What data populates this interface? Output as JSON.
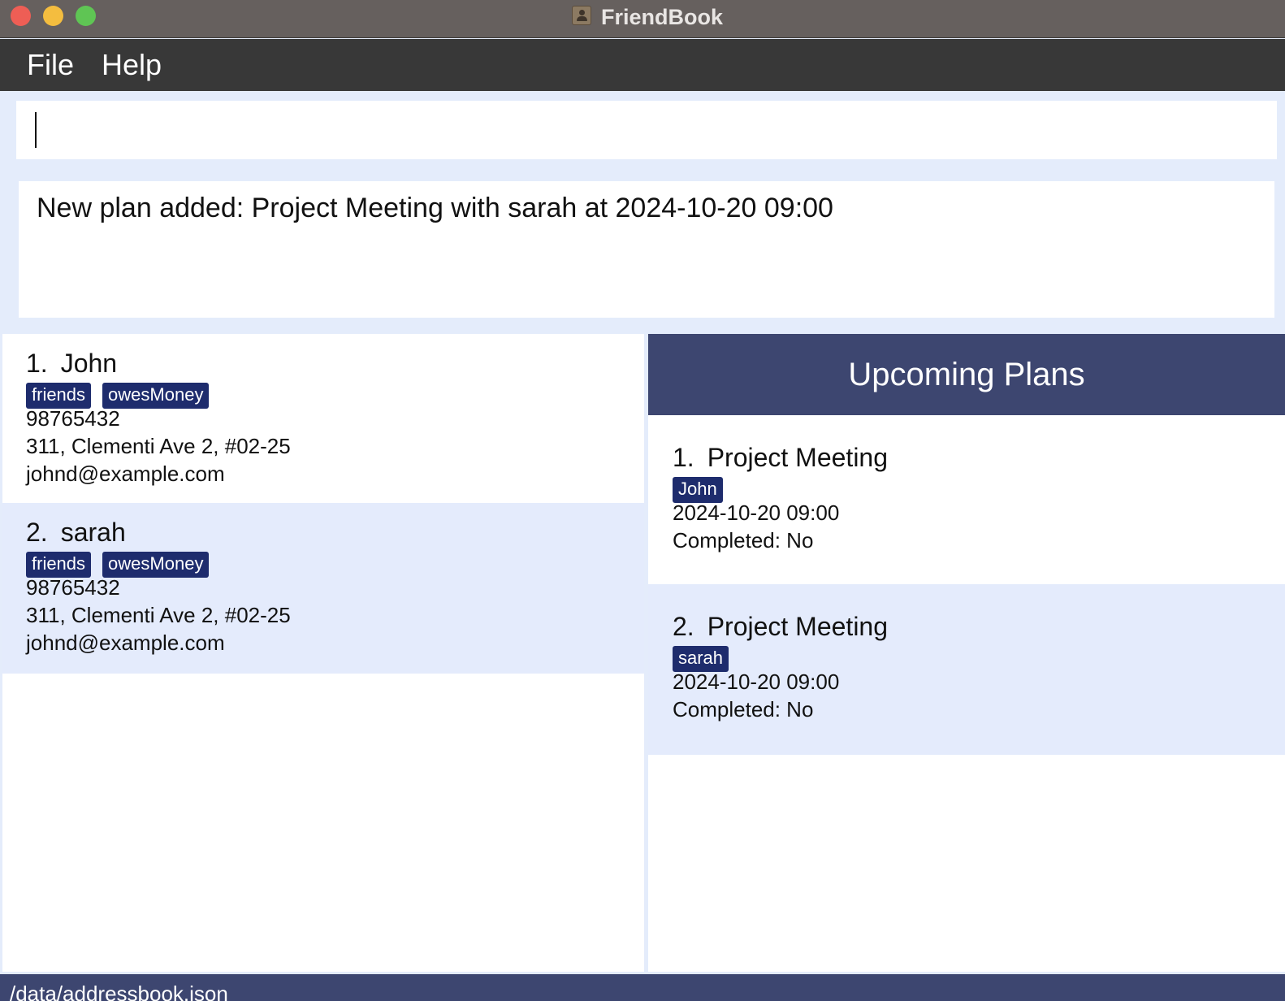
{
  "window": {
    "title": "FriendBook"
  },
  "menu": {
    "file": "File",
    "help": "Help"
  },
  "command": {
    "value": "",
    "placeholder": ""
  },
  "result": {
    "message": "New plan added: Project Meeting with sarah at 2024-10-20 09:00"
  },
  "persons": [
    {
      "index": "1.",
      "name": "John",
      "tags": [
        "friends",
        "owesMoney"
      ],
      "phone": "98765432",
      "address": "311, Clementi Ave 2, #02-25",
      "email": "johnd@example.com"
    },
    {
      "index": "2.",
      "name": "sarah",
      "tags": [
        "friends",
        "owesMoney"
      ],
      "phone": "98765432",
      "address": "311, Clementi Ave 2, #02-25",
      "email": "johnd@example.com"
    }
  ],
  "plans": {
    "header": "Upcoming Plans",
    "items": [
      {
        "index": "1.",
        "title": "Project Meeting",
        "person": "John",
        "datetime": "2024-10-20 09:00",
        "completed": "Completed: No"
      },
      {
        "index": "2.",
        "title": "Project Meeting",
        "person": "sarah",
        "datetime": "2024-10-20 09:00",
        "completed": "Completed: No"
      }
    ]
  },
  "status": {
    "path": "/data/addressbook.json"
  },
  "colors": {
    "titlebar": "#66605e",
    "menubar": "#383838",
    "background": "#e4ecfb",
    "tag": "#1e2c6d",
    "header": "#3d4670",
    "alt_row": "#e4ebfc"
  }
}
